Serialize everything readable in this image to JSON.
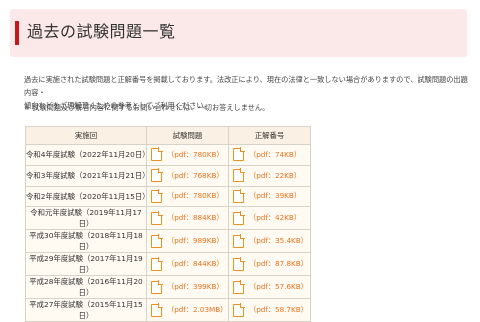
{
  "header": {
    "title": "過去の試験問題一覧"
  },
  "intro": {
    "line1": "過去に実施された試験問題と正解番号を掲載しております。法改正により、現在の法律と一致しない場合がありますので、試験問題の出題内容・",
    "line2": "傾向などをご理解頂くための参考としてご利用ください。"
  },
  "note": "※ 試験問題及び解答内容に関するお問い合わせには、一切お答えしません。",
  "table": {
    "headers": [
      "実施回",
      "試験問題",
      "正解番号"
    ],
    "rows": [
      {
        "exam": "令和4年度試験（2022年11月20日）",
        "problem": "（pdf：780KB）",
        "answer": "（pdf：74KB）"
      },
      {
        "exam": "令和3年度試験（2021年11月21日）",
        "problem": "（pdf：768KB）",
        "answer": "（pdf：22KB）"
      },
      {
        "exam": "令和2年度試験（2020年11月15日）",
        "problem": "（pdf：780KB）",
        "answer": "（pdf：39KB）"
      },
      {
        "exam": "令和元年度試験（2019年11月17日）",
        "problem": "（pdf：884KB）",
        "answer": "（pdf：42KB）"
      },
      {
        "exam": "平成30年度試験（2018年11月18日）",
        "problem": "（pdf：989KB）",
        "answer": "（pdf：35.4KB）"
      },
      {
        "exam": "平成29年度試験（2017年11月19日）",
        "problem": "（pdf：844KB）",
        "answer": "（pdf：87.8KB）"
      },
      {
        "exam": "平成28年度試験（2016年11月20日）",
        "problem": "（pdf：399KB）",
        "answer": "（pdf：57.6KB）"
      },
      {
        "exam": "平成27年度試験（2015年11月15日）",
        "problem": "（pdf：2.03MB）",
        "answer": "（pdf：58.7KB）"
      }
    ]
  }
}
